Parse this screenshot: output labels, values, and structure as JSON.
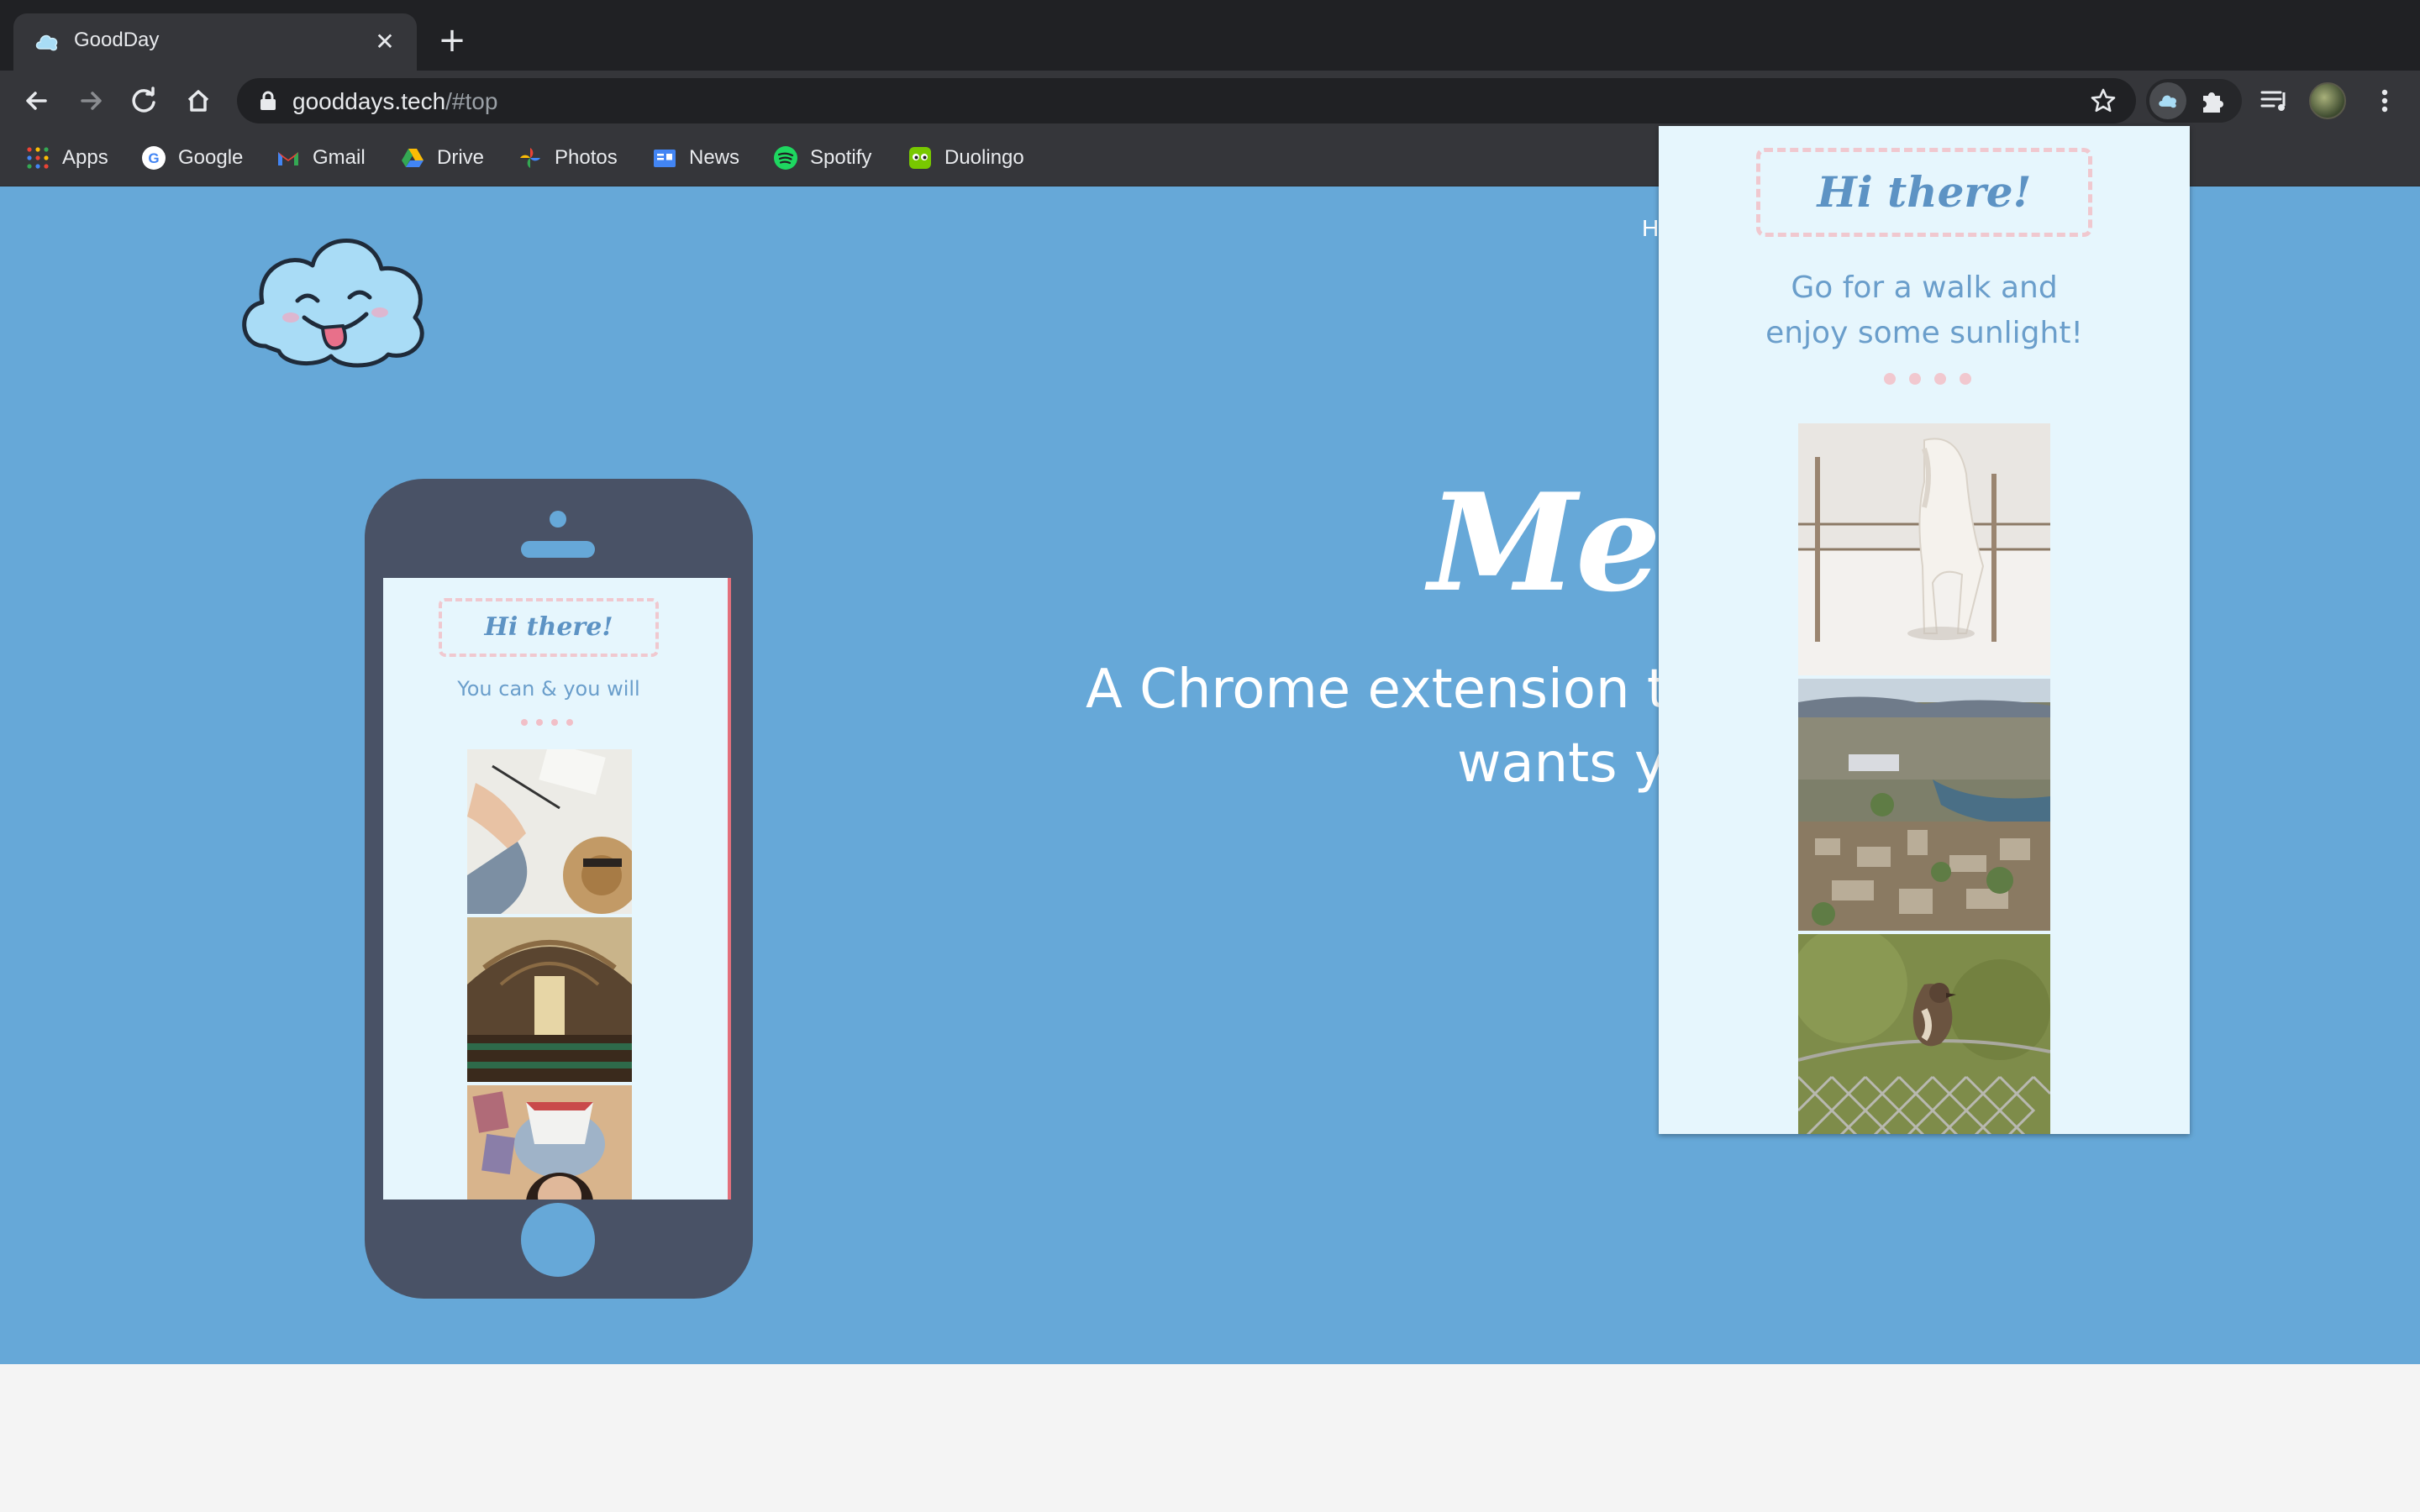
{
  "browser": {
    "tab": {
      "title": "GoodDay",
      "close_label": "✕"
    },
    "new_tab_label": "+",
    "url": {
      "host": "gooddays.tech",
      "path": "/#top"
    },
    "bookmarks": [
      {
        "label": "Apps",
        "icon": "apps-grid-icon"
      },
      {
        "label": "Google",
        "icon": "google-icon"
      },
      {
        "label": "Gmail",
        "icon": "gmail-icon"
      },
      {
        "label": "Drive",
        "icon": "drive-icon"
      },
      {
        "label": "Photos",
        "icon": "photos-icon"
      },
      {
        "label": "News",
        "icon": "news-icon"
      },
      {
        "label": "Spotify",
        "icon": "spotify-icon"
      },
      {
        "label": "Duolingo",
        "icon": "duolingo-icon"
      }
    ]
  },
  "page": {
    "nav_fragment": "H",
    "headline": "Mee",
    "subtitle_line1": "A Chrome extension that",
    "subtitle_line2": "wants yo",
    "phone": {
      "greeting": "Hi there!",
      "message": "You can & you will"
    }
  },
  "popup": {
    "greeting": "Hi there!",
    "message_line1": "Go for a walk and",
    "message_line2": "enjoy some sunlight!",
    "photos": [
      "white-horse-in-snow",
      "city-aerial-view",
      "sparrow-on-fence"
    ]
  },
  "colors": {
    "hero_bg": "#66a8d8",
    "popup_bg": "#e6f6fd",
    "accent_text": "#5d93c4",
    "dashed_border": "#f0c8cf",
    "phone_body": "#495266"
  }
}
